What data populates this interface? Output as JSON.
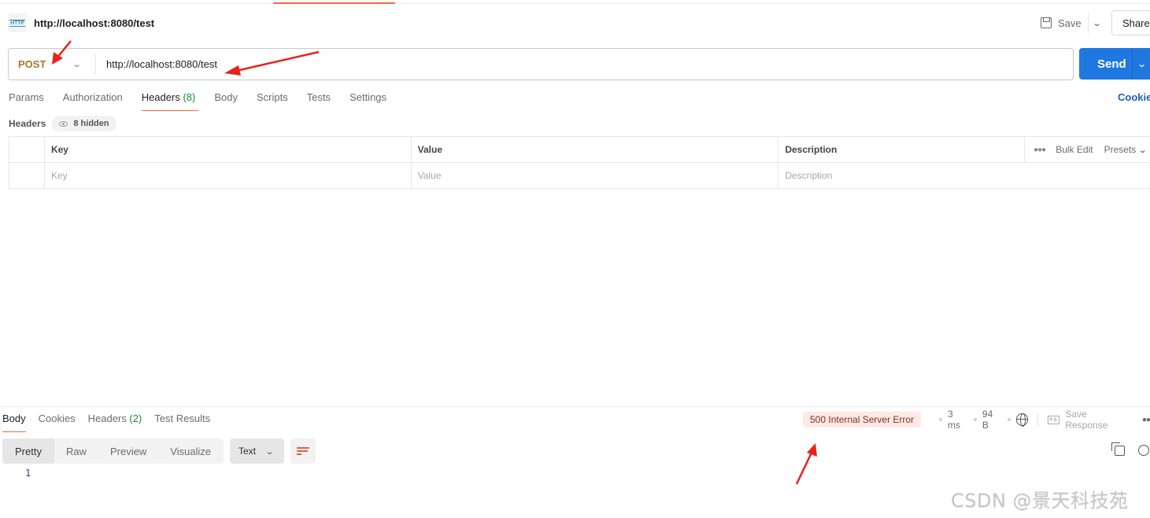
{
  "request": {
    "title": "http://localhost:8080/test",
    "icon": "http-icon",
    "icon_text": "HTTP",
    "save_label": "Save",
    "share_label": "Share",
    "method": "POST",
    "url": "http://localhost:8080/test",
    "send_label": "Send",
    "tabs": [
      {
        "label": "Params"
      },
      {
        "label": "Authorization"
      },
      {
        "label": "Headers",
        "count": "(8)",
        "active": true
      },
      {
        "label": "Body"
      },
      {
        "label": "Scripts"
      },
      {
        "label": "Tests"
      },
      {
        "label": "Settings"
      }
    ],
    "cookies_link": "Cookie",
    "headers_label": "Headers",
    "hidden_label": "8 hidden",
    "table": {
      "columns": [
        "Key",
        "Value",
        "Description"
      ],
      "bulk_edit": "Bulk Edit",
      "presets": "Presets",
      "placeholders": {
        "key": "Key",
        "value": "Value",
        "description": "Description"
      }
    }
  },
  "response": {
    "tabs": [
      {
        "label": "Body",
        "active": true
      },
      {
        "label": "Cookies"
      },
      {
        "label": "Headers",
        "count": "(2)"
      },
      {
        "label": "Test Results"
      }
    ],
    "status": "500 Internal Server Error",
    "time": "3 ms",
    "size": "94 B",
    "save_response": "Save Response",
    "eg_icon_text": "e.g.",
    "formats": [
      "Pretty",
      "Raw",
      "Preview",
      "Visualize"
    ],
    "selected_format": "Pretty",
    "text_type": "Text",
    "line_numbers": [
      "1"
    ]
  },
  "watermark": "CSDN @景天科技苑",
  "colors": {
    "accent": "#f26b3a",
    "send": "#1f78e0",
    "method": "#a8762b",
    "status_bg": "#fde9e6",
    "status_text": "#8c2a1a",
    "annotation_arrow": "#e8221a"
  }
}
